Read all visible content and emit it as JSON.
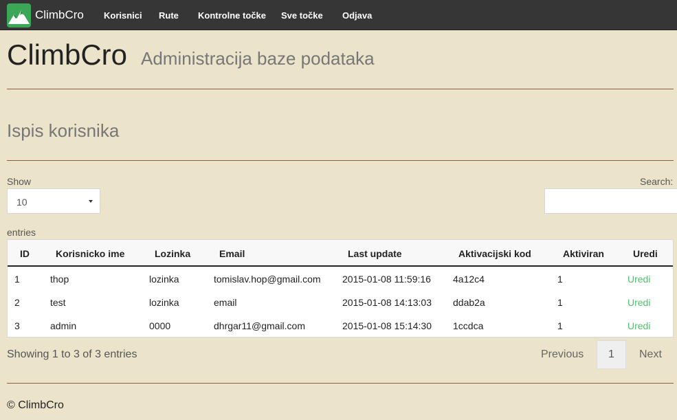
{
  "navbar": {
    "brand": "ClimbCro",
    "items": [
      "Korisnici",
      "Rute",
      "Kontrolne točke",
      "Sve točke",
      "Odjava"
    ]
  },
  "header": {
    "title": "ClimbCro",
    "subtitle": "Administracija baze podataka"
  },
  "section": {
    "title": "Ispis korisnika"
  },
  "table_controls": {
    "show_label": "Show",
    "length_value": "10",
    "entries_label": "entries",
    "search_label": "Search:",
    "search_value": ""
  },
  "table": {
    "columns": [
      "ID",
      "Korisnicko ime",
      "Lozinka",
      "Email",
      "Last update",
      "Aktivacijski kod",
      "Aktiviran",
      "Uredi"
    ],
    "rows": [
      {
        "id": "1",
        "username": "thop",
        "password": "lozinka",
        "email": "tomislav.hop@gmail.com",
        "last_update": "2015-01-08 11:59:16",
        "code": "4a12c4",
        "active": "1",
        "edit": "Uredi"
      },
      {
        "id": "2",
        "username": "test",
        "password": "lozinka",
        "email": "email",
        "last_update": "2015-01-08 14:13:03",
        "code": "ddab2a",
        "active": "1",
        "edit": "Uredi"
      },
      {
        "id": "3",
        "username": "admin",
        "password": "0000",
        "email": "dhrgar11@gmail.com",
        "last_update": "2015-01-08 15:14:30",
        "code": "1ccdca",
        "active": "1",
        "edit": "Uredi"
      }
    ]
  },
  "pagination": {
    "info": "Showing 1 to 3 of 3 entries",
    "previous": "Previous",
    "current": "1",
    "next": "Next"
  },
  "footer": {
    "text": "© ClimbCro"
  },
  "colors": {
    "background": "#ebe3ca",
    "navbar": "#363636",
    "logo": "#3aa856",
    "link": "#4cc26a",
    "divider": "#8c5b49"
  },
  "icons": {
    "brand": "mountain-icon",
    "select": "caret-down-icon"
  }
}
